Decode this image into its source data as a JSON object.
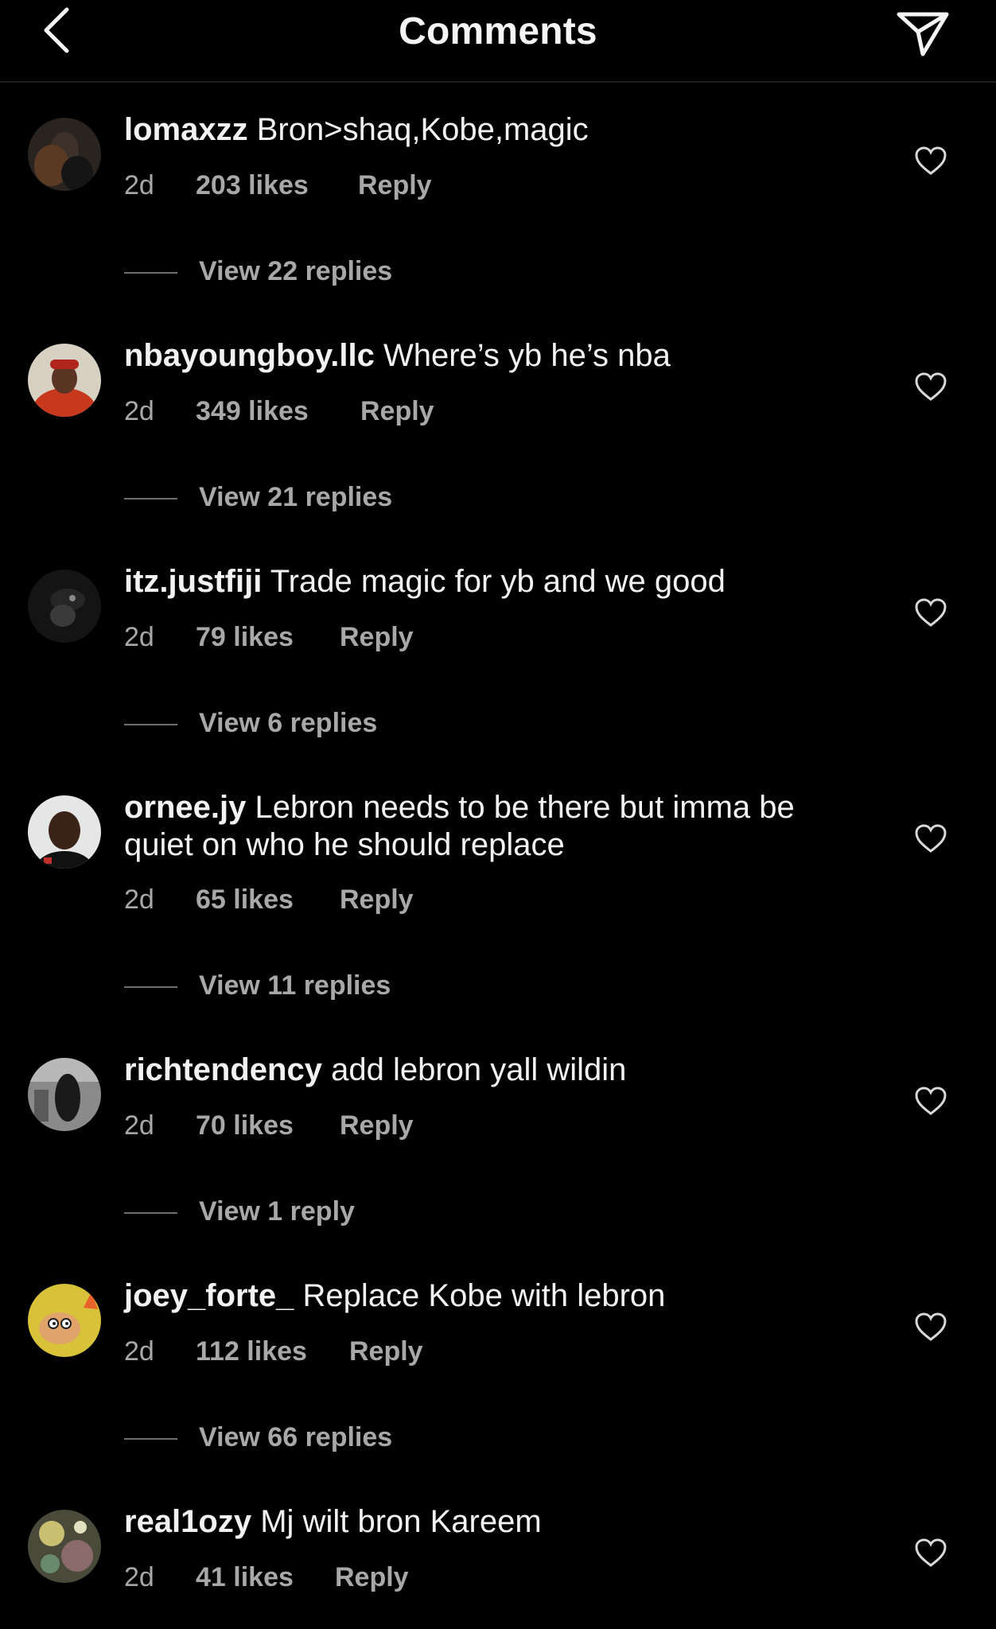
{
  "header": {
    "title": "Comments",
    "back_icon": "chevron-left-icon",
    "share_icon": "paper-plane-icon"
  },
  "colors": {
    "background": "#000000",
    "text": "#f2f2f2",
    "muted": "#a8a8a8"
  },
  "comments": [
    {
      "username": "lomaxzz",
      "text": "Bron>shaq,Kobe,magic",
      "time": "2d",
      "likes": "203 likes",
      "reply": "Reply",
      "view_replies": "View 22 replies"
    },
    {
      "username": "nbayoungboy.llc",
      "text": "Where’s yb he’s nba",
      "time": "2d",
      "likes": "349 likes",
      "reply": "Reply",
      "view_replies": "View 21 replies"
    },
    {
      "username": "itz.justfiji",
      "text": "Trade magic for yb and we good",
      "time": "2d",
      "likes": "79 likes",
      "reply": "Reply",
      "view_replies": "View 6 replies"
    },
    {
      "username": "ornee.jy",
      "text": "Lebron needs to be there but imma be quiet on who he should replace",
      "time": "2d",
      "likes": "65 likes",
      "reply": "Reply",
      "view_replies": "View 11 replies"
    },
    {
      "username": "richtendency",
      "text": "add lebron yall wildin",
      "time": "2d",
      "likes": "70 likes",
      "reply": "Reply",
      "view_replies": "View 1 reply"
    },
    {
      "username": "joey_forte_",
      "text": "Replace Kobe with lebron",
      "time": "2d",
      "likes": "112 likes",
      "reply": "Reply",
      "view_replies": "View 66 replies"
    },
    {
      "username": "real1ozy",
      "text": "Mj wilt bron Kareem",
      "time": "2d",
      "likes": "41 likes",
      "reply": "Reply",
      "view_replies": ""
    }
  ]
}
